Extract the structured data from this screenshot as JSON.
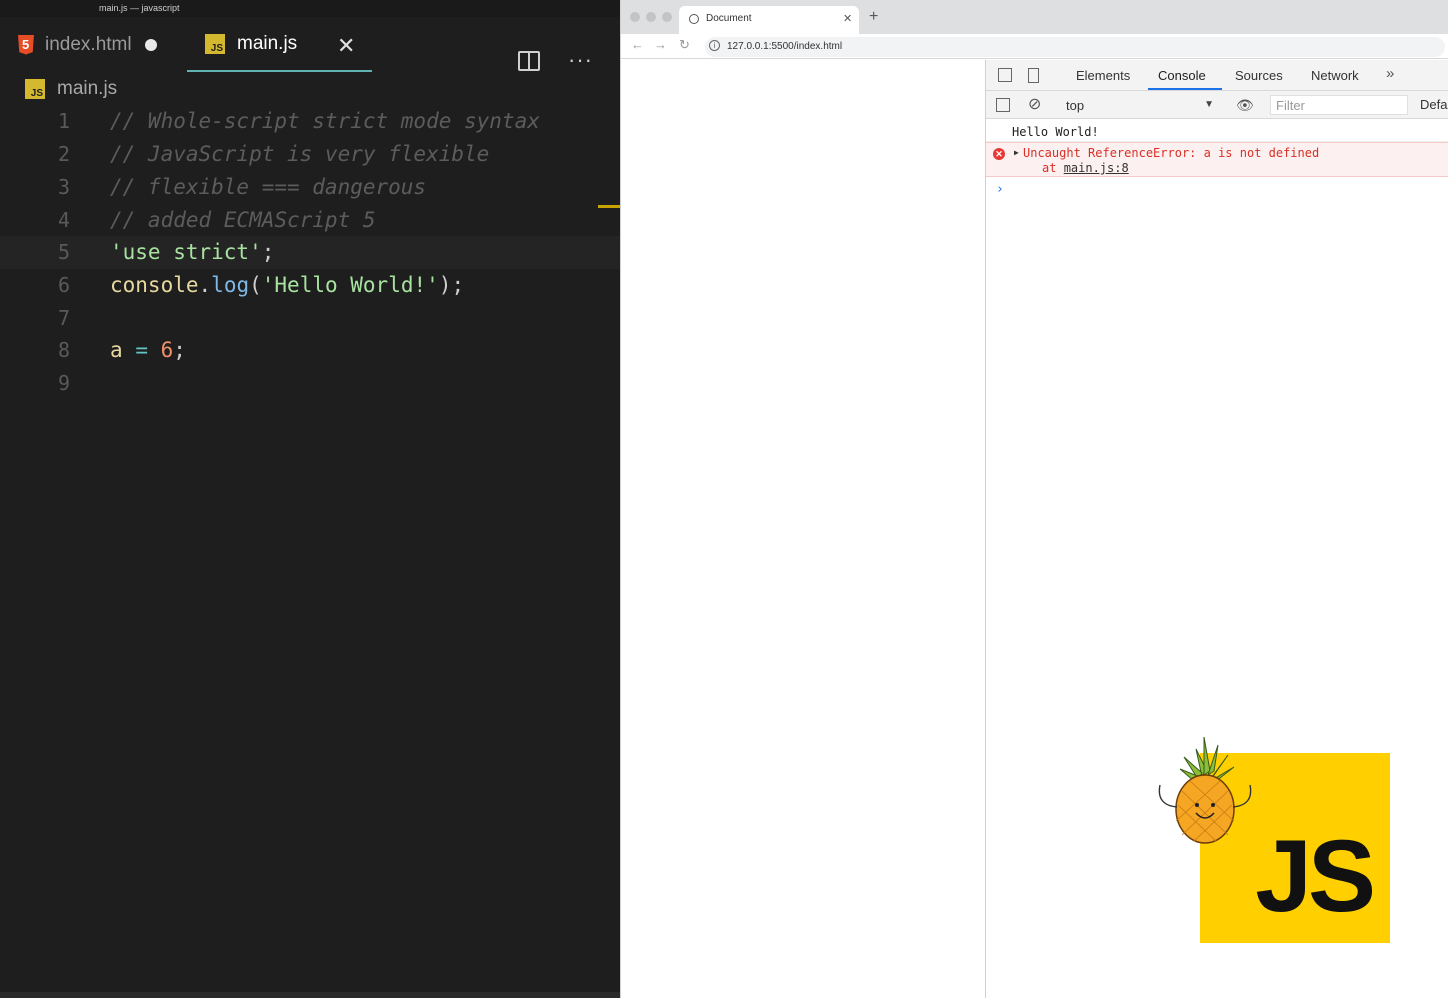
{
  "vscode": {
    "window_title": "main.js — javascript",
    "tabs": [
      {
        "label": "index.html",
        "modified": true
      },
      {
        "label": "main.js",
        "active": true
      }
    ],
    "breadcrumb": "main.js",
    "lines": [
      {
        "num": "1",
        "text": "// Whole-script strict mode syntax"
      },
      {
        "num": "2",
        "text": "// JavaScript is very flexible"
      },
      {
        "num": "3",
        "text": "// flexible === dangerous"
      },
      {
        "num": "4",
        "text": "// added ECMAScript 5"
      },
      {
        "num": "5",
        "text": "'use strict';"
      },
      {
        "num": "6",
        "text": "console.log('Hello World!');"
      },
      {
        "num": "7",
        "text": ""
      },
      {
        "num": "8",
        "text": "a = 6;"
      },
      {
        "num": "9",
        "text": ""
      }
    ]
  },
  "browser": {
    "tab_title": "Document",
    "url": "127.0.0.1:5500/index.html",
    "devtools": {
      "tabs": [
        "Elements",
        "Console",
        "Sources",
        "Network"
      ],
      "active_tab": "Console",
      "context": "top",
      "filter_placeholder": "Filter",
      "levels": "Default levels",
      "console": {
        "log": "Hello World!",
        "error_message": "Uncaught ReferenceError: a is not defined",
        "error_at_prefix": "at ",
        "error_location": "main.js:8",
        "prompt": "›"
      }
    }
  },
  "logo": {
    "text": "JS",
    "color": "#ffcf00"
  },
  "colors": {
    "editor_bg": "#1e1e1e",
    "accent_tab": "#5fb3b3",
    "error": "#d93025"
  }
}
